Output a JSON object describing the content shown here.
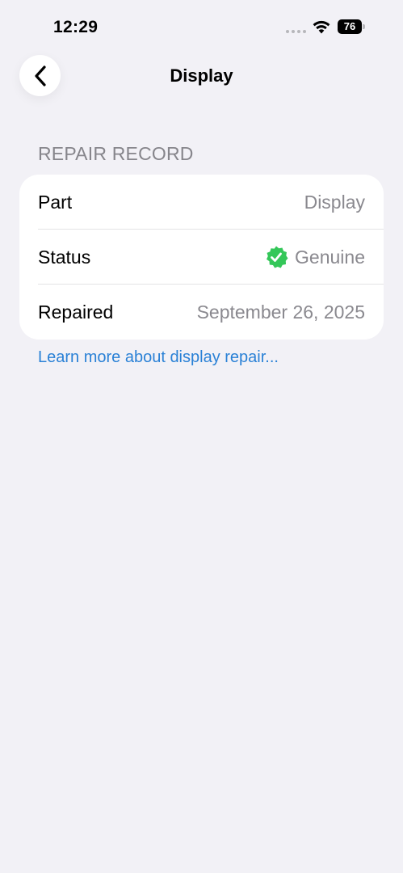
{
  "status_bar": {
    "time": "12:29",
    "battery": "76"
  },
  "nav": {
    "title": "Display"
  },
  "section": {
    "header": "REPAIR RECORD"
  },
  "rows": [
    {
      "label": "Part",
      "value": "Display"
    },
    {
      "label": "Status",
      "value": "Genuine"
    },
    {
      "label": "Repaired",
      "value": "September 26, 2025"
    }
  ],
  "link": {
    "text": "Learn more about display repair..."
  },
  "colors": {
    "background": "#f2f1f6",
    "card": "#ffffff",
    "secondary_text": "#8a898f",
    "link": "#2a81d6",
    "genuine_badge": "#34c759"
  }
}
